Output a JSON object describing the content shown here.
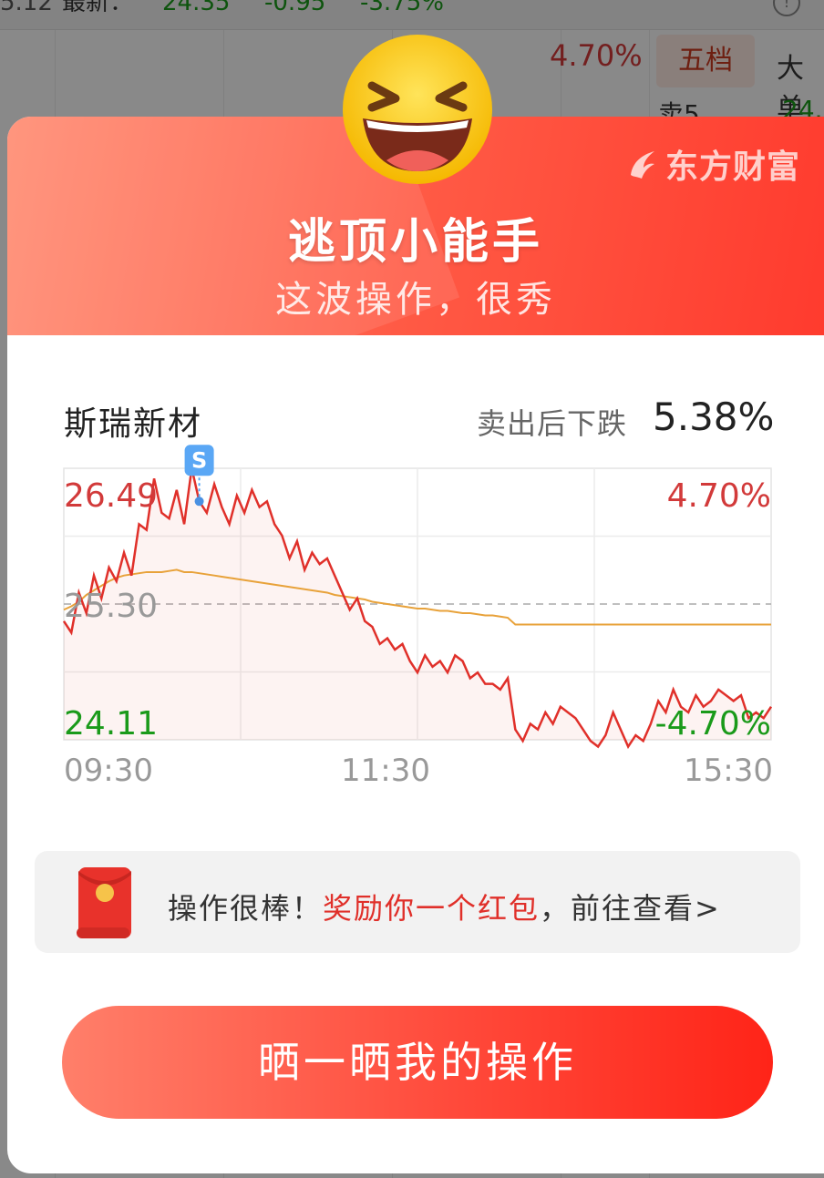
{
  "background": {
    "prev_close": "5.12",
    "latest_label": "最新：",
    "latest_price": "24.35",
    "change": "-0.95",
    "change_pct": "-3.75%",
    "chart_pct": "4.70%",
    "tab_wudang": "五档",
    "tab_dadan": "大单",
    "sell5_label": "卖5",
    "sell5_value": "24."
  },
  "modal": {
    "brand": "东方财富",
    "title": "逃顶小能手",
    "subtitle": "这波操作，很秀",
    "stock_name": "斯瑞新材",
    "drop_label": "卖出后下跌",
    "drop_value": "5.38%",
    "reward_prefix": "操作很棒！",
    "reward_highlight": "奖励你一个红包",
    "reward_suffix": "，前往查看>",
    "share_button": "晒一晒我的操作"
  },
  "chart_data": {
    "type": "line",
    "x_labels": [
      "09:30",
      "11:30",
      "15:30"
    ],
    "y_high": "26.49",
    "y_mid": "25.30",
    "y_low": "24.11",
    "pct_high": "4.70%",
    "pct_low": "-4.70%",
    "ylim": [
      24.11,
      26.49
    ],
    "prev_close": 25.3,
    "sell_marker": "S",
    "colors": {
      "price": "#e0302a",
      "avg": "#e8a23a",
      "up": "#d23a3a",
      "down": "#1a9a1a"
    },
    "series": [
      {
        "values": [
          25.15,
          25.05,
          25.4,
          25.22,
          25.55,
          25.35,
          25.62,
          25.5,
          25.75,
          25.55,
          26.0,
          25.95,
          26.4,
          26.1,
          26.05,
          26.3,
          26.0,
          26.49,
          26.2,
          26.1,
          26.35,
          26.15,
          26.0,
          26.25,
          26.1,
          26.3,
          26.15,
          26.2,
          26.0,
          25.9,
          25.7,
          25.85,
          25.6,
          25.75,
          25.65,
          25.7,
          25.55,
          25.4,
          25.25,
          25.35,
          25.15,
          25.1,
          24.95,
          25.0,
          24.9,
          24.95,
          24.8,
          24.7,
          24.85,
          24.75,
          24.8,
          24.7,
          24.85,
          24.8,
          24.65,
          24.7,
          24.6,
          24.6,
          24.55,
          24.65,
          24.2,
          24.1,
          24.25,
          24.2,
          24.35,
          24.25,
          24.4,
          24.35,
          24.3,
          24.2,
          24.1,
          24.05,
          24.15,
          24.35,
          24.2,
          24.05,
          24.15,
          24.1,
          24.25,
          24.45,
          24.35,
          24.55,
          24.4,
          24.35,
          24.5,
          24.4,
          24.45,
          24.55,
          24.5,
          24.45,
          24.5,
          24.3,
          24.35,
          24.3,
          24.4
        ],
        "avg": [
          25.25,
          25.28,
          25.32,
          25.38,
          25.42,
          25.46,
          25.5,
          25.53,
          25.55,
          25.56,
          25.57,
          25.58,
          25.58,
          25.58,
          25.59,
          25.6,
          25.58,
          25.58,
          25.57,
          25.56,
          25.55,
          25.54,
          25.53,
          25.52,
          25.51,
          25.5,
          25.49,
          25.48,
          25.47,
          25.46,
          25.45,
          25.44,
          25.43,
          25.42,
          25.41,
          25.4,
          25.38,
          25.37,
          25.36,
          25.35,
          25.34,
          25.32,
          25.31,
          25.3,
          25.29,
          25.28,
          25.27,
          25.26,
          25.26,
          25.25,
          25.24,
          25.24,
          25.23,
          25.22,
          25.22,
          25.21,
          25.2,
          25.2,
          25.19,
          25.18,
          25.12,
          25.12,
          25.12,
          25.12,
          25.12,
          25.12,
          25.12,
          25.12,
          25.12,
          25.12,
          25.12,
          25.12,
          25.12,
          25.12,
          25.12,
          25.12,
          25.12,
          25.12,
          25.12,
          25.12,
          25.12,
          25.12,
          25.12,
          25.12,
          25.12,
          25.12,
          25.12,
          25.12,
          25.12,
          25.12,
          25.12,
          25.12,
          25.12,
          25.12,
          25.12
        ]
      }
    ],
    "sell_index": 18
  }
}
